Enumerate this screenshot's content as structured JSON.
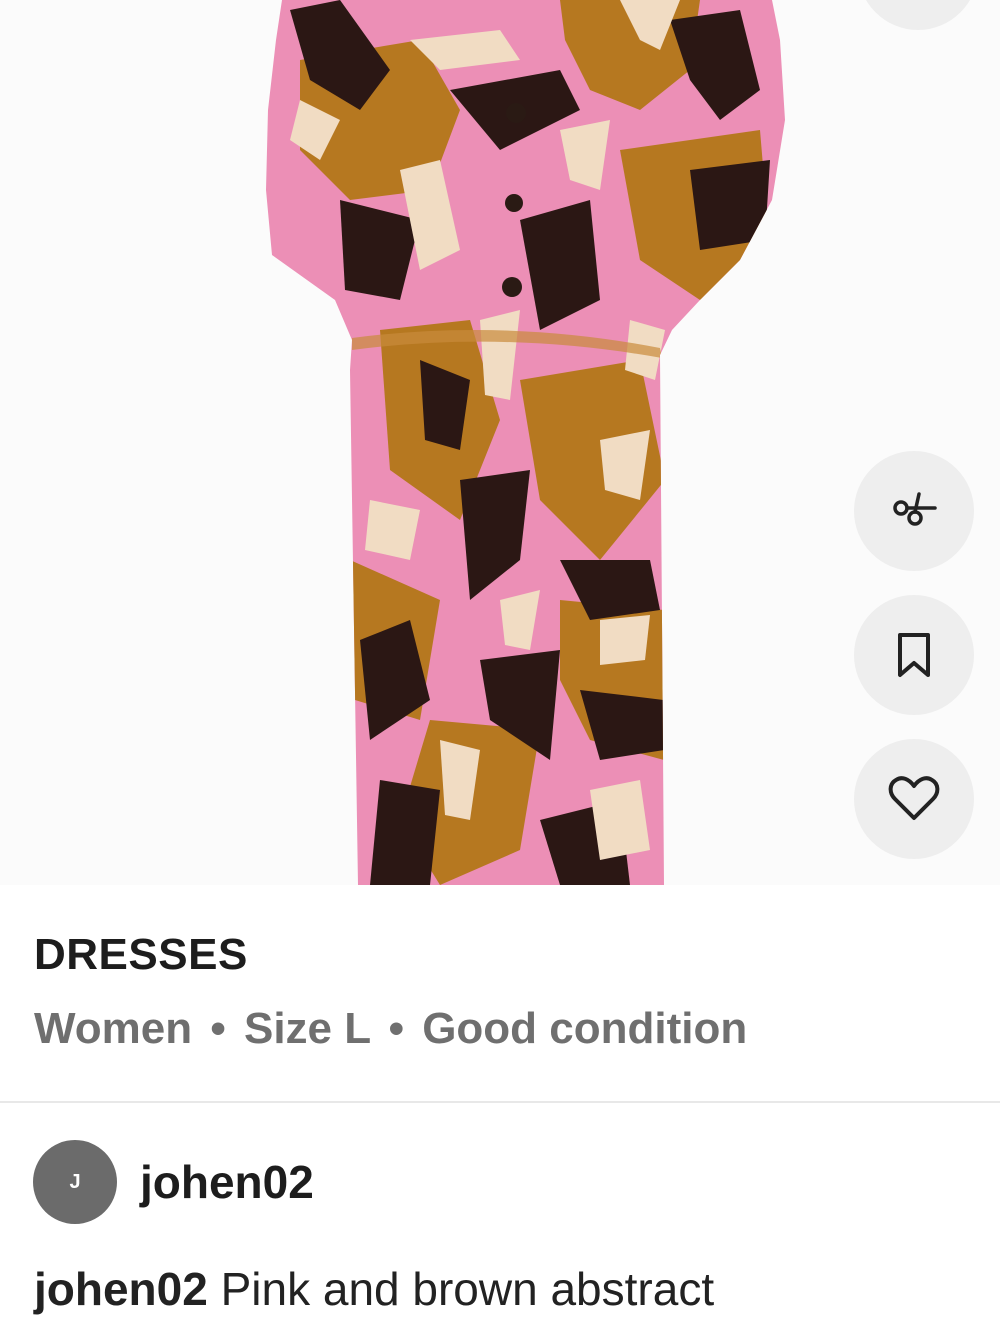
{
  "listing": {
    "category": "DRESSES",
    "gender": "Women",
    "size": "Size L",
    "condition": "Good condition",
    "separator": "•"
  },
  "seller": {
    "avatar_initial": "J",
    "username": "johen02"
  },
  "description": {
    "username": "johen02",
    "text": "Pink and brown abstract"
  },
  "actions": {
    "share_icon": "share-icon",
    "save_icon": "bookmark-icon",
    "like_icon": "heart-icon"
  },
  "colors": {
    "dress_pink": "#ec8fb6",
    "dress_mustard": "#b67820",
    "dress_brown": "#2b1714",
    "dress_cream": "#f1dcc3",
    "button_bg": "#eeeeee",
    "avatar_bg": "#6b6b6b",
    "meta_text": "#6f6f6f"
  }
}
